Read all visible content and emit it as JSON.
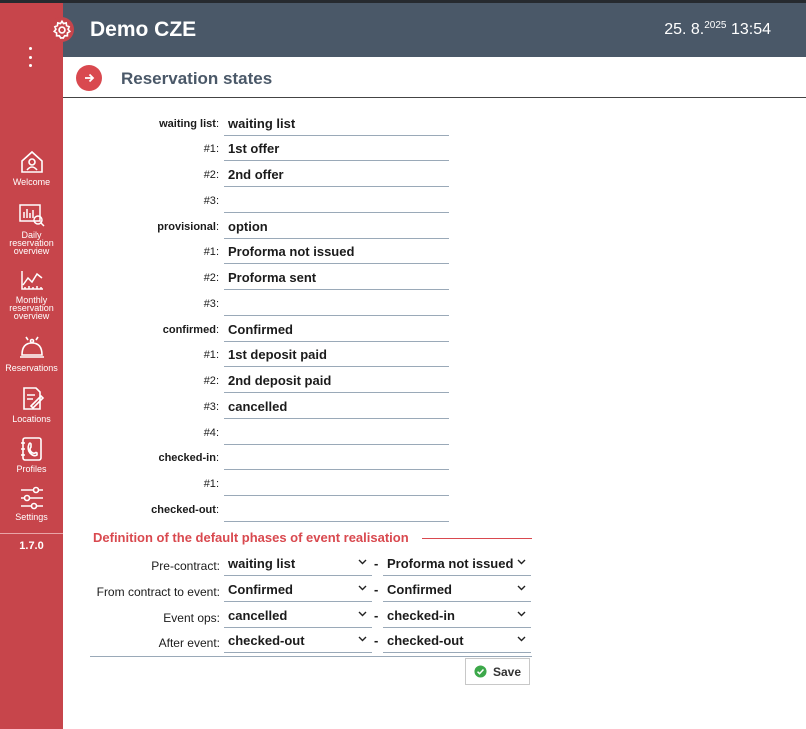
{
  "app": {
    "title": "Demo CZE"
  },
  "clock": {
    "day_month": "25. 8.",
    "year": "2025",
    "time": "13:54"
  },
  "page": {
    "title": "Reservation states"
  },
  "sidebar": {
    "items": [
      {
        "label": "Welcome",
        "icon": "house-icon"
      },
      {
        "label": "Daily reservation overview",
        "icon": "daily-chart-icon"
      },
      {
        "label": "Monthly reservation overview",
        "icon": "monthly-chart-icon"
      },
      {
        "label": "Reservations",
        "icon": "bell-icon"
      },
      {
        "label": "Locations",
        "icon": "document-edit-icon"
      },
      {
        "label": "Profiles",
        "icon": "contacts-icon"
      },
      {
        "label": "Settings",
        "icon": "sliders-icon"
      }
    ],
    "version": "1.7.0"
  },
  "states": [
    {
      "label": "waiting list",
      "bold": true,
      "value": "waiting list"
    },
    {
      "label": "#1",
      "bold": false,
      "value": "1st offer"
    },
    {
      "label": "#2",
      "bold": false,
      "value": "2nd offer"
    },
    {
      "label": "#3",
      "bold": false,
      "value": ""
    },
    {
      "label": "provisional",
      "bold": true,
      "value": "option"
    },
    {
      "label": "#1",
      "bold": false,
      "value": "Proforma not issued"
    },
    {
      "label": "#2",
      "bold": false,
      "value": "Proforma sent"
    },
    {
      "label": "#3",
      "bold": false,
      "value": ""
    },
    {
      "label": "confirmed",
      "bold": true,
      "value": "Confirmed"
    },
    {
      "label": "#1",
      "bold": false,
      "value": "1st deposit paid"
    },
    {
      "label": "#2",
      "bold": false,
      "value": "2nd deposit paid"
    },
    {
      "label": "#3",
      "bold": false,
      "value": "cancelled"
    },
    {
      "label": "#4",
      "bold": false,
      "value": ""
    },
    {
      "label": "checked-in",
      "bold": true,
      "value": ""
    },
    {
      "label": "#1",
      "bold": false,
      "value": ""
    },
    {
      "label": "checked-out",
      "bold": true,
      "value": ""
    }
  ],
  "phases": {
    "title": "Definition of the default phases of event realisation",
    "rows": [
      {
        "label": "Pre-contract:",
        "from": "waiting list",
        "to": "Proforma not issued"
      },
      {
        "label": "From contract to event:",
        "from": "Confirmed",
        "to": "Confirmed"
      },
      {
        "label": "Event ops:",
        "from": "cancelled",
        "to": "checked-in"
      },
      {
        "label": "After event:",
        "from": "checked-out",
        "to": "checked-out"
      }
    ]
  },
  "save": {
    "label": "Save"
  },
  "colors": {
    "sidebar": "#c7454b",
    "header": "#4a5868",
    "accent": "#d9494f",
    "save_check": "#3ca84a"
  }
}
